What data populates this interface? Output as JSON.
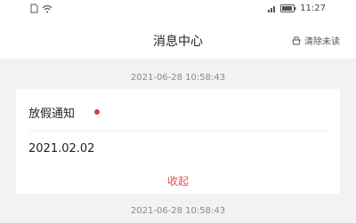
{
  "status_bar": {
    "time": "11:27",
    "left_icons": [
      "sim-icon",
      "wifi-icon"
    ],
    "right_icons": [
      "signal-icon",
      "battery-icon"
    ]
  },
  "header": {
    "title": "消息中心",
    "clear_unread_label": "清除未读",
    "clear_unread_icon": "broom-icon"
  },
  "messages": [
    {
      "time": "2021-06-28 10:58:43",
      "title": "放假通知",
      "unread": true,
      "body": "2021.02.02",
      "collapse_label": "收起"
    },
    {
      "time": "2021-06-28 10:58:43"
    }
  ],
  "colors": {
    "accent": "#e05050",
    "unread_dot": "#e23a3a",
    "background": "#f2f2f2"
  }
}
